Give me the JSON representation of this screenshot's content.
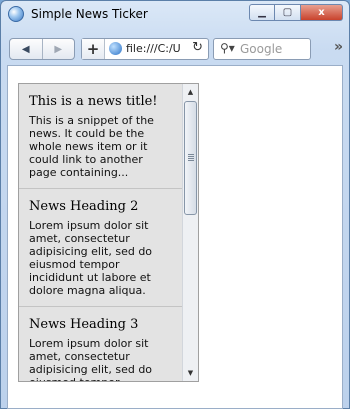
{
  "window": {
    "title": "Simple News Ticker",
    "controls": {
      "close_label": "x"
    }
  },
  "toolbar": {
    "url": "file:///C:/U",
    "search_placeholder": "Google"
  },
  "ticker": {
    "items": [
      {
        "title": "This is a news title!",
        "text": "This is a snippet of the news. It could be the whole news item or it could link to another page containing..."
      },
      {
        "title": "News Heading 2",
        "text": "Lorem ipsum dolor sit amet, consectetur adipisicing elit, sed do eiusmod tempor incididunt ut labore et dolore magna aliqua."
      },
      {
        "title": "News Heading 3",
        "text": "Lorem ipsum dolor sit amet, consectetur adipisicing elit, sed do eiusmod tempor incididunt ut labore et dolore magna aliqua."
      }
    ]
  }
}
